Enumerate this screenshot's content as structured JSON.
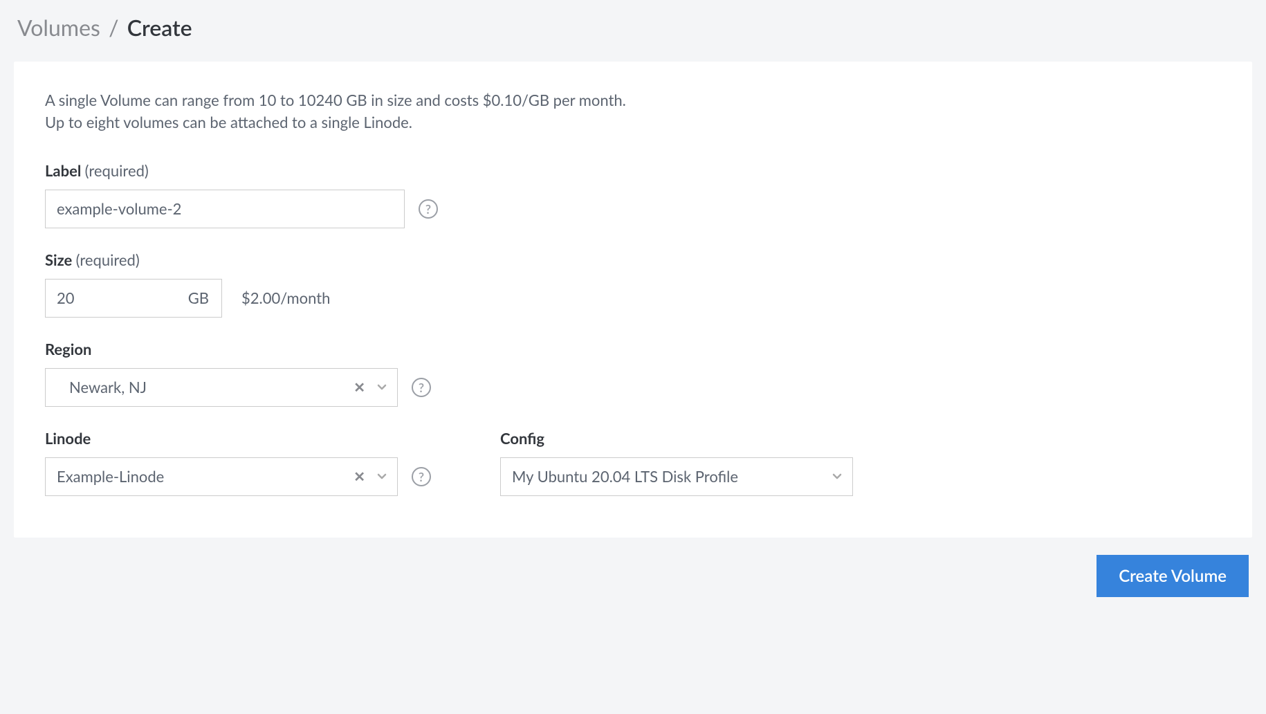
{
  "breadcrumb": {
    "parent": "Volumes",
    "separator": "/",
    "current": "Create"
  },
  "description": {
    "line1": "A single Volume can range from 10 to 10240 GB in size and costs $0.10/GB per month.",
    "line2": "Up to eight volumes can be attached to a single Linode."
  },
  "form": {
    "label": {
      "title": "Label",
      "required": "(required)",
      "value": "example-volume-2"
    },
    "size": {
      "title": "Size",
      "required": "(required)",
      "value": "20",
      "unit": "GB",
      "price": "$2.00/month"
    },
    "region": {
      "title": "Region",
      "value": "Newark, NJ",
      "flag": "us"
    },
    "linode": {
      "title": "Linode",
      "value": "Example-Linode"
    },
    "config": {
      "title": "Config",
      "value": "My Ubuntu 20.04 LTS Disk Profile"
    }
  },
  "actions": {
    "submit": "Create Volume"
  },
  "icons": {
    "help": "?",
    "clear": "✕"
  }
}
